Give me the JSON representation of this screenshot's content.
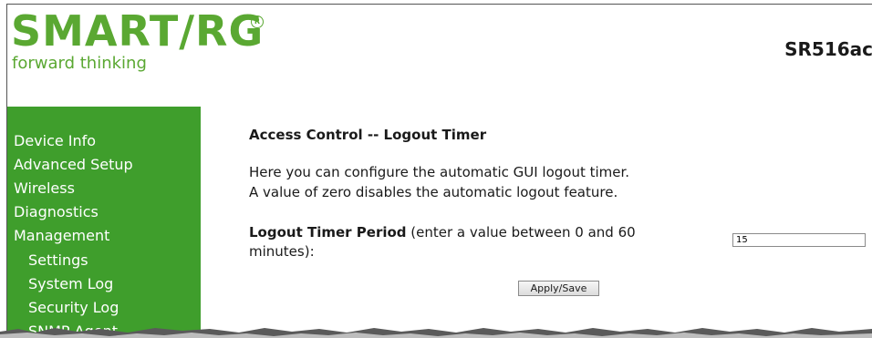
{
  "header": {
    "logo_text": "SMART/RG",
    "logo_reg": "R",
    "tagline": "forward thinking",
    "model": "SR516ac"
  },
  "sidebar": {
    "items": [
      {
        "label": "Device Info"
      },
      {
        "label": "Advanced Setup"
      },
      {
        "label": "Wireless"
      },
      {
        "label": "Diagnostics"
      },
      {
        "label": "Management"
      },
      {
        "label": "Settings"
      },
      {
        "label": "System Log"
      },
      {
        "label": "Security Log"
      },
      {
        "label": "SNMP Agent"
      }
    ]
  },
  "main": {
    "title": "Access Control -- Logout Timer",
    "desc_line1": "Here you can configure the automatic GUI logout timer.",
    "desc_line2": "A value of zero disables the automatic logout feature.",
    "field_label_bold": "Logout Timer Period",
    "field_label_rest": " (enter a value between 0 and 60 minutes):",
    "timer_value": "15",
    "apply_label": "Apply/Save"
  },
  "colors": {
    "brand_green": "#5aa832",
    "sidebar_green": "#3f9e2c"
  }
}
